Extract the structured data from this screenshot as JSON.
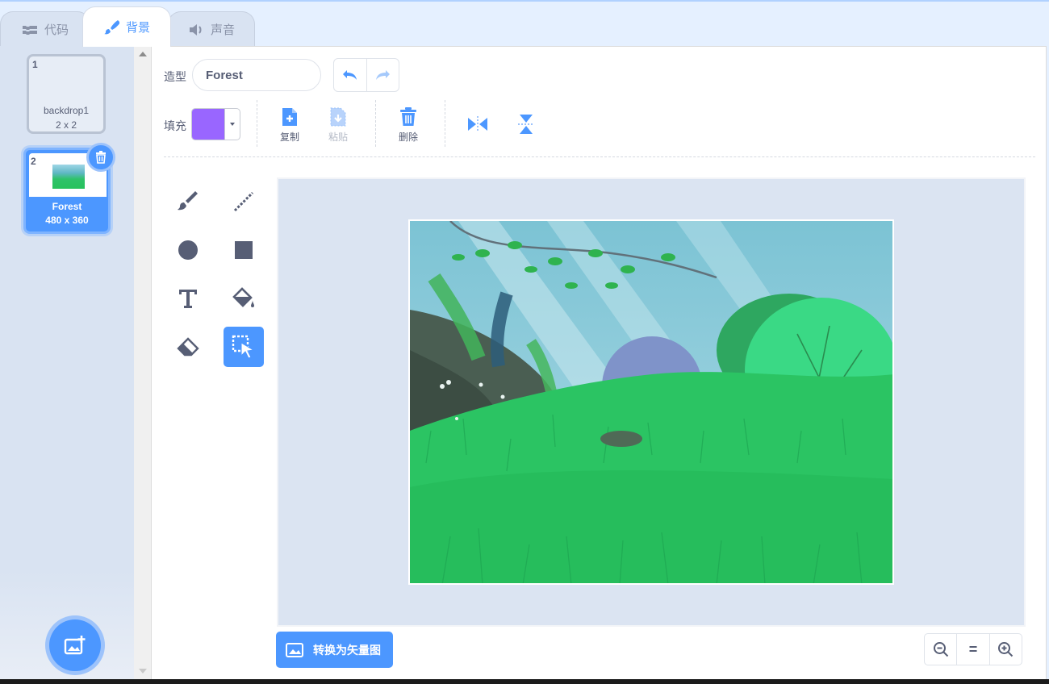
{
  "tabs": {
    "code": "代码",
    "backdrops": "背景",
    "sounds": "声音"
  },
  "backdrop_list": {
    "items": [
      {
        "number": "1",
        "name": "backdrop1",
        "size": "2 x 2"
      },
      {
        "number": "2",
        "name": "Forest",
        "size": "480 x 360"
      }
    ],
    "selected_index": 1
  },
  "editor": {
    "costume_label": "造型",
    "costume_name": "Forest",
    "fill_label": "填充",
    "fill_color": "#9966ff",
    "actions": {
      "copy": "复制",
      "paste": "粘贴",
      "delete": "删除"
    },
    "convert_button": "转换为矢量图",
    "zoom": {
      "zoom_out": "−",
      "reset": "=",
      "zoom_in": "+"
    }
  },
  "icons": {
    "tab_code": "code-blocks-icon",
    "tab_backdrops": "paintbrush-icon",
    "tab_sounds": "speaker-icon",
    "tools": [
      "brush-icon",
      "line-icon",
      "circle-icon",
      "rectangle-icon",
      "text-icon",
      "fill-bucket-icon",
      "eraser-icon",
      "select-icon"
    ]
  },
  "colors": {
    "accent": "#4c97ff",
    "text": "#575e75",
    "pane_bg": "#d9e3f2"
  }
}
